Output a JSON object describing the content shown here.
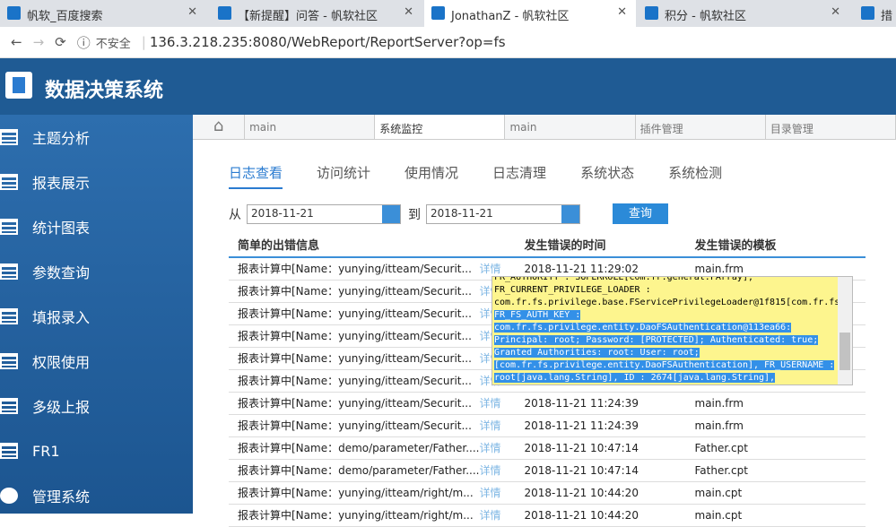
{
  "browser": {
    "tabs": [
      "帆软_百度搜索",
      "【新提醒】问答 - 帆软社区",
      "JonathanZ - 帆软社区",
      "积分 - 帆软社区",
      "措"
    ],
    "insecure": "不安全",
    "url": "136.3.218.235:8080/WebReport/ReportServer?op=fs"
  },
  "app": {
    "title": "数据决策系统"
  },
  "sidebar": [
    "主题分析",
    "报表展示",
    "统计图表",
    "参数查询",
    "填报录入",
    "权限使用",
    "多级上报",
    "FR1",
    "管理系统"
  ],
  "page_tabs": [
    "main",
    "系统监控",
    "main",
    "插件管理",
    "目录管理"
  ],
  "sub_tabs": [
    "日志查看",
    "访问统计",
    "使用情况",
    "日志清理",
    "系统状态",
    "系统检测"
  ],
  "filter": {
    "from_label": "从",
    "from": "2018-11-21",
    "to_label": "到",
    "to": "2018-11-21",
    "query": "查询"
  },
  "table": {
    "headers": [
      "简单的出错信息",
      "发生错误的时间",
      "发生错误的模板"
    ],
    "detail": "详情",
    "rows": [
      [
        "报表计算中[Name：yunying/itteam/Securit...",
        "2018-11-21 11:29:02",
        "main.frm"
      ],
      [
        "报表计算中[Name：yunying/itteam/Securit...",
        "",
        ""
      ],
      [
        "报表计算中[Name：yunying/itteam/Securit...",
        "",
        ""
      ],
      [
        "报表计算中[Name：yunying/itteam/Securit...",
        "",
        ""
      ],
      [
        "报表计算中[Name：yunying/itteam/Securit...",
        "",
        ""
      ],
      [
        "报表计算中[Name：yunying/itteam/Securit...",
        "",
        ""
      ],
      [
        "报表计算中[Name：yunying/itteam/Securit...",
        "2018-11-21 11:24:39",
        "main.frm"
      ],
      [
        "报表计算中[Name：yunying/itteam/Securit...",
        "2018-11-21 11:24:39",
        "main.frm"
      ],
      [
        "报表计算中[Name：demo/parameter/Father....",
        "2018-11-21 10:47:14",
        "Father.cpt"
      ],
      [
        "报表计算中[Name：demo/parameter/Father....",
        "2018-11-21 10:47:14",
        "Father.cpt"
      ],
      [
        "报表计算中[Name：yunying/itteam/right/m...",
        "2018-11-21 10:44:20",
        "main.cpt"
      ],
      [
        "报表计算中[Name：yunying/itteam/right/m...",
        "2018-11-21 10:44:20",
        "main.cpt"
      ]
    ]
  },
  "popup": {
    "lines": [
      "FR_AUTHORITY : SUPERROLE[com.fr.general.FArray],",
      "FR_CURRENT_PRIVILEGE_LOADER :",
      "com.fr.fs.privilege.base.FServicePrivilegeLoader@1f815[com.fr.fs"
    ],
    "selected": [
      "FR_FS_AUTH_KEY :",
      "com.fr.fs.privilege.entity.DaoFSAuthentication@113ea66:",
      "Principal: root; Password: [PROTECTED]; Authenticated: true;",
      "Granted Authorities: root: User: root;",
      "[com.fr.fs.privilege.entity.DaoFSAuthentication], FR_USERNAME :",
      "root[java.lang.String], ID : 2674[java.lang.String],"
    ]
  }
}
